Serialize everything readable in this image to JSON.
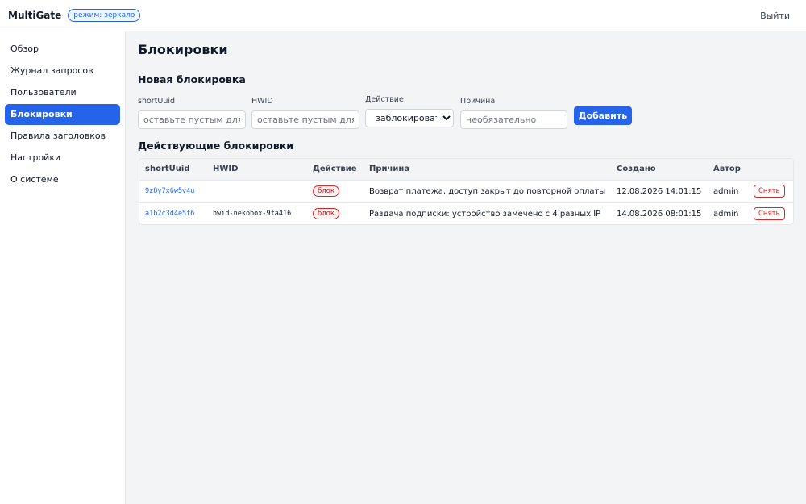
{
  "header": {
    "brand": "MultiGate",
    "mode_badge": "режим: зеркало",
    "logout": "Выйти"
  },
  "sidebar": {
    "items": [
      {
        "label": "Обзор"
      },
      {
        "label": "Журнал запросов"
      },
      {
        "label": "Пользователи"
      },
      {
        "label": "Блокировки",
        "active": true
      },
      {
        "label": "Правила заголовков"
      },
      {
        "label": "Настройки"
      },
      {
        "label": "О системе"
      }
    ]
  },
  "page": {
    "title": "Блокировки"
  },
  "new_block": {
    "title": "Новая блокировка",
    "short_uuid_label": "shortUuid",
    "short_uuid_placeholder": "оставьте пустым для блокировки по HWID",
    "hwid_label": "HWID",
    "hwid_placeholder": "оставьте пустым для блокировки по shortUuid",
    "action_label": "Действие",
    "action_selected": "заблокировать",
    "reason_label": "Причина",
    "reason_placeholder": "необязательно",
    "add_button": "Добавить"
  },
  "active_blocks": {
    "title": "Действующие блокировки",
    "columns": [
      "shortUuid",
      "HWID",
      "Действие",
      "Причина",
      "Создано",
      "Автор",
      ""
    ],
    "rows": [
      {
        "short_uuid": "9z8y7x6w5v4u",
        "hwid": "",
        "action": "блок",
        "reason": "Возврат платежа, доступ закрыт до повторной оплаты",
        "created": "12.08.2026 14:01:15",
        "author": "admin",
        "remove": "Снять"
      },
      {
        "short_uuid": "a1b2c3d4e5f6",
        "hwid": "hwid-nekobox-9fa416",
        "action": "блок",
        "reason": "Раздача подписки: устройство замечено с 4 разных IP",
        "created": "14.08.2026 08:01:15",
        "author": "admin",
        "remove": "Снять"
      }
    ]
  },
  "colors": {
    "accent": "#2563eb",
    "danger": "#dc2626",
    "background": "#f3f4f6"
  }
}
